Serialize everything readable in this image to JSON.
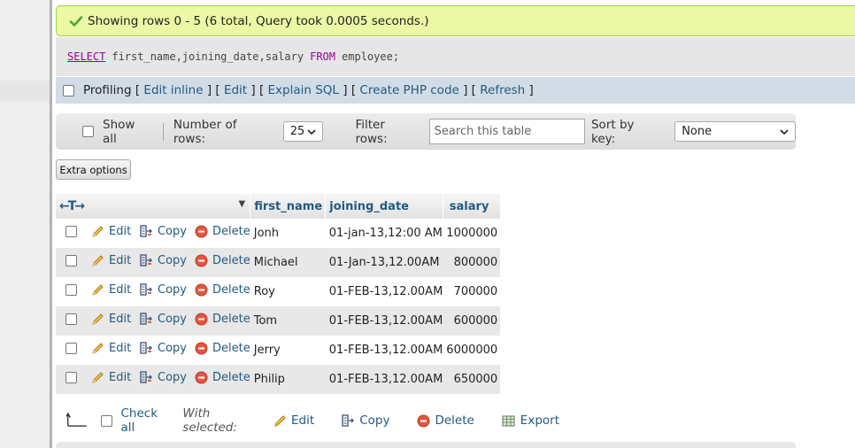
{
  "message": {
    "text": "Showing rows 0 - 5 (6 total, Query took 0.0005 seconds.)"
  },
  "sql": {
    "kw_select": "SELECT",
    "columns": "first_name,joining_date,salary",
    "kw_from": "FROM",
    "table": "employee;"
  },
  "profiling": {
    "label": "Profiling",
    "links": [
      "Edit inline",
      "Edit",
      "Explain SQL",
      "Create PHP code",
      "Refresh"
    ]
  },
  "navigation": {
    "show_all": "Show all",
    "rows_label": "Number of rows:",
    "rows_value": "25",
    "filter_label": "Filter rows:",
    "filter_placeholder": "Search this table",
    "sort_label": "Sort by key:",
    "sort_value": "None"
  },
  "extra_options": "Extra options",
  "table": {
    "headers": [
      "first_name",
      "joining_date",
      "salary"
    ],
    "action_labels": {
      "edit": "Edit",
      "copy": "Copy",
      "delete": "Delete"
    },
    "rows": [
      {
        "first_name": "Jonh",
        "joining_date": "01-jan-13,12:00 AM",
        "salary": "1000000"
      },
      {
        "first_name": "Michael",
        "joining_date": "01-Jan-13,12.00AM",
        "salary": "800000"
      },
      {
        "first_name": "Roy",
        "joining_date": "01-FEB-13,12.00AM",
        "salary": "700000"
      },
      {
        "first_name": "Tom",
        "joining_date": "01-FEB-13,12.00AM",
        "salary": "600000"
      },
      {
        "first_name": "Jerry",
        "joining_date": "01-FEB-13,12.00AM",
        "salary": "6000000"
      },
      {
        "first_name": "Philip",
        "joining_date": "01-FEB-13,12.00AM",
        "salary": "650000"
      }
    ]
  },
  "bulk": {
    "check_all": "Check all",
    "with_selected": "With selected:",
    "edit": "Edit",
    "copy": "Copy",
    "delete": "Delete",
    "export": "Export"
  },
  "colors": {
    "success_bg": "#ebf8a4",
    "link": "#235a81",
    "sql_keyword": "#990099",
    "profiling_bg": "#d1dce6"
  },
  "icons": [
    "check-icon",
    "pencil-icon",
    "copy-icon",
    "delete-icon",
    "export-icon",
    "column-move-arrows-icon",
    "sort-desc-icon",
    "arrow-up-left-icon"
  ]
}
